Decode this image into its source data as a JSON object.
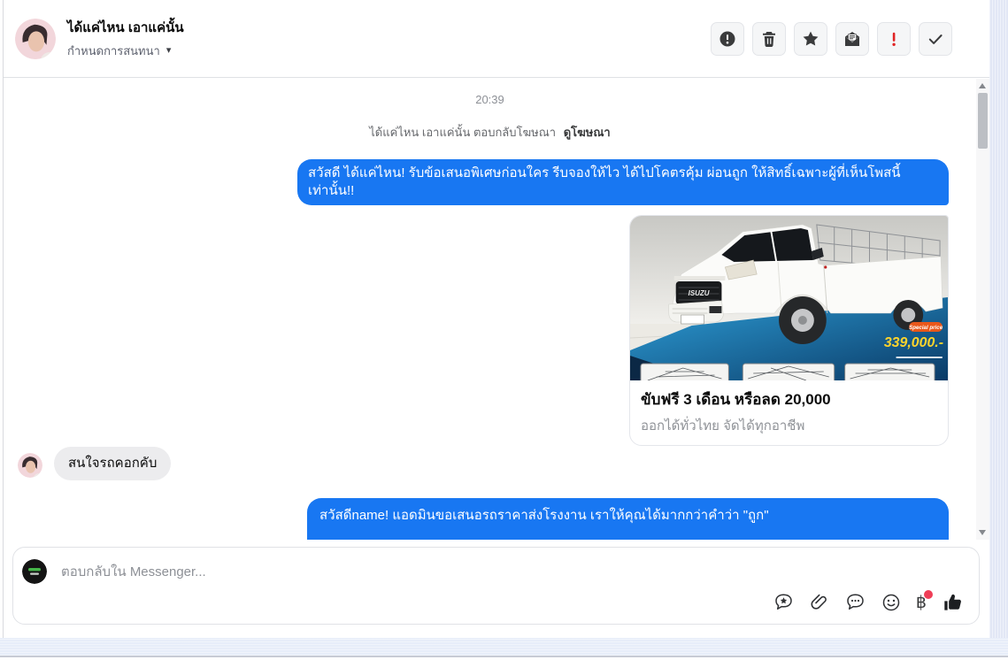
{
  "header": {
    "name": "ได้แค่ไหน เอาแค่นั้น",
    "status": "กำหนดการสนทนา",
    "toolbar": [
      {
        "icon": "exclamation-circle-icon"
      },
      {
        "icon": "trash-icon"
      },
      {
        "icon": "star-icon"
      },
      {
        "icon": "mark-unread-envelope-icon"
      },
      {
        "icon": "priority-exclamation-icon"
      },
      {
        "icon": "mark-done-check-icon"
      }
    ]
  },
  "icons": {
    "chevron_down": "▾"
  },
  "conversation": {
    "timestamp": "20:39",
    "system_prefix": "ได้แค่ไหน เอาแค่นั้น ตอบกลับโฆษณา",
    "system_link": "ดูโฆษณา",
    "outgoing_1": "สวัสดี ได้แค่ไหน! รับข้อเสนอพิเศษก่อนใคร รีบจองให้ไว ได้ไปโคตรคุ้ม ผ่อนถูก ให้สิทธิ์เฉพาะผู้ที่เห็นโพสนี้เท่านั้น!!",
    "incoming_1": "สนใจรถคอกคับ",
    "outgoing_2": "สวัสดีname! แอดมินขอเสนอรถราคาส่งโรงงาน เราให้คุณได้มากกว่าคำว่า \"ถูก\"",
    "attachment": {
      "title": "ขับฟรี 3 เดือน หรือลด 20,000",
      "subtitle": "ออกได้ทั่วไทย จัดได้ทุกอาชีพ",
      "ad": {
        "brand": "ISUZU",
        "badge": "Special price",
        "price": "339,000.-"
      }
    }
  },
  "composer": {
    "placeholder": "ตอบกลับใน Messenger...",
    "baht": "฿"
  },
  "colors": {
    "outgoing_bubble": "#1877f2",
    "incoming_bubble": "#ececee",
    "price_yellow": "#ffd42c",
    "badge_orange": "#e8571a",
    "alert_red": "#e02424",
    "notification_dot": "#ef3e57"
  }
}
